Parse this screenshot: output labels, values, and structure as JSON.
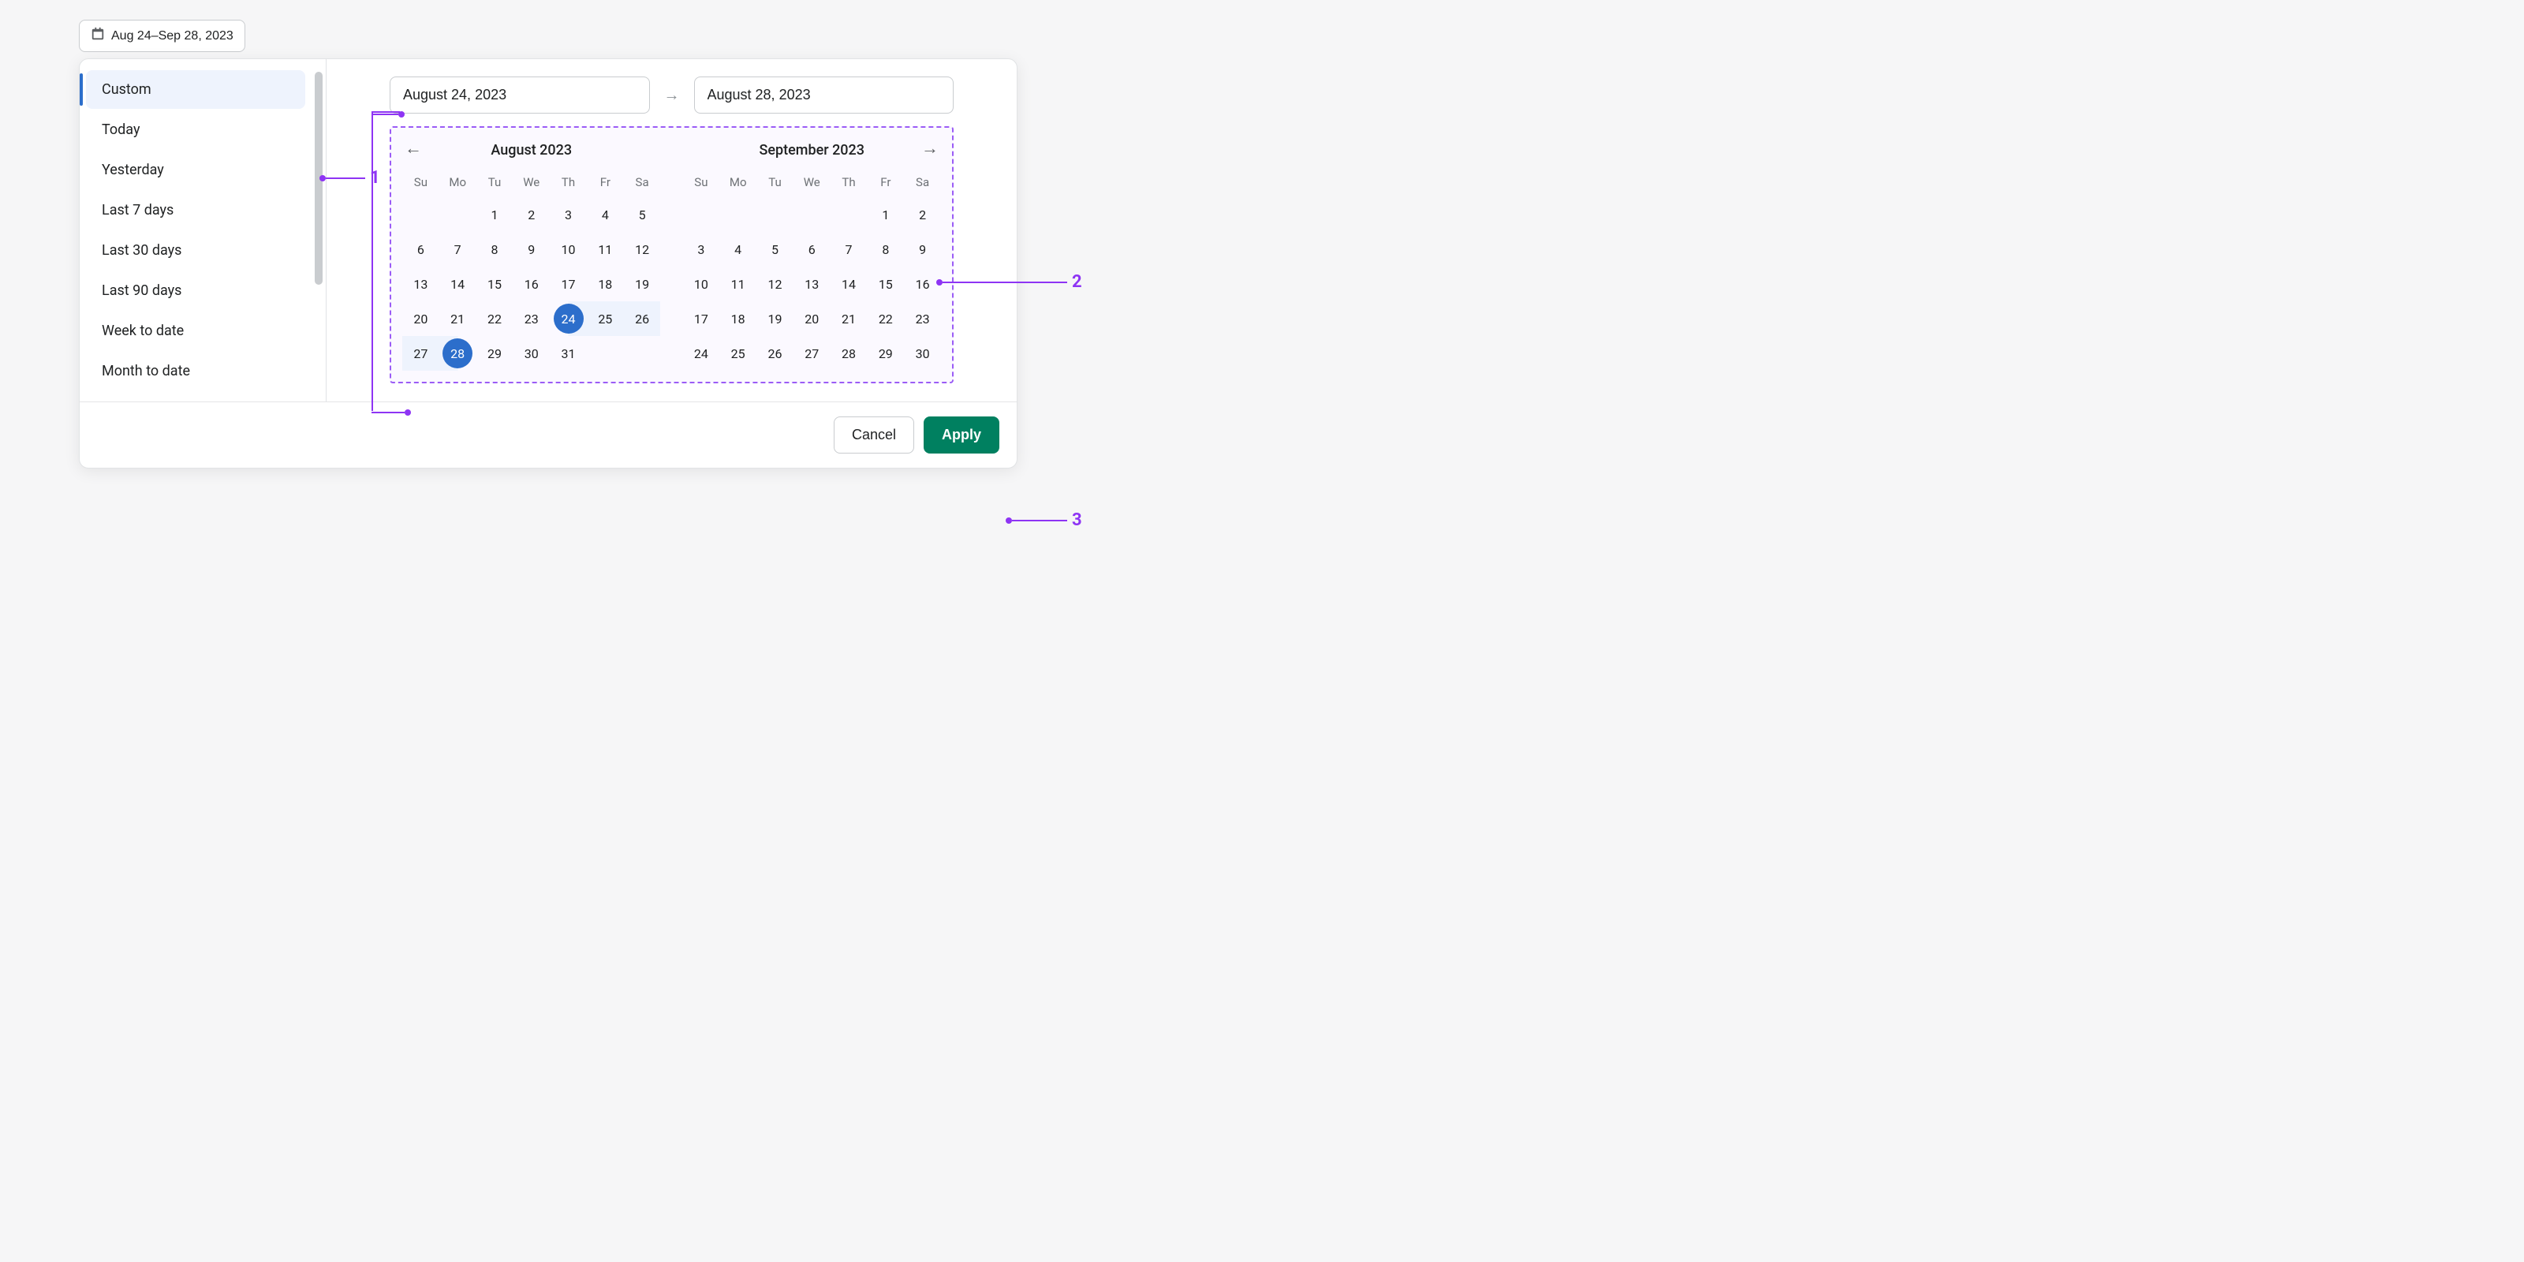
{
  "trigger": {
    "label": "Aug 24–Sep 28, 2023"
  },
  "presets": {
    "items": [
      {
        "label": "Custom",
        "selected": true
      },
      {
        "label": "Today"
      },
      {
        "label": "Yesterday"
      },
      {
        "label": "Last 7 days"
      },
      {
        "label": "Last 30 days"
      },
      {
        "label": "Last 90 days"
      },
      {
        "label": "Week to date"
      },
      {
        "label": "Month to date"
      }
    ]
  },
  "inputs": {
    "start": "August 24, 2023",
    "end": "August 28, 2023"
  },
  "dow": [
    "Su",
    "Mo",
    "Tu",
    "We",
    "Th",
    "Fr",
    "Sa"
  ],
  "months": [
    {
      "title": "August 2023",
      "lead_blanks": 2,
      "days": 31,
      "range_start": 24,
      "range_end": 28,
      "in_range": [
        25,
        26,
        27
      ]
    },
    {
      "title": "September 2023",
      "lead_blanks": 5,
      "days": 30,
      "range_start": null,
      "range_end": null,
      "in_range": []
    }
  ],
  "footer": {
    "cancel": "Cancel",
    "apply": "Apply"
  },
  "annotations": {
    "a1": "1",
    "a2": "2",
    "a3": "3"
  }
}
